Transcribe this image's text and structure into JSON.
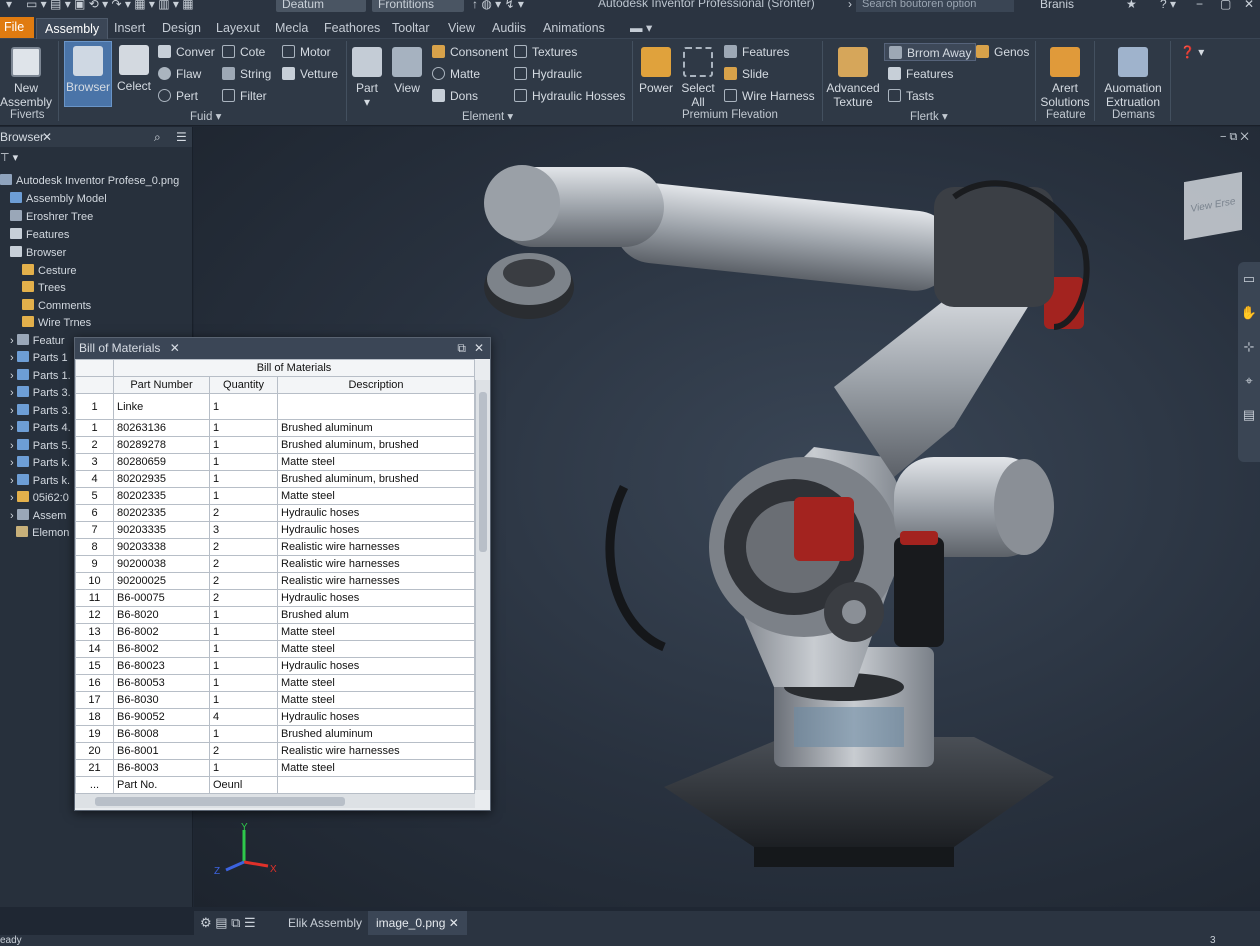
{
  "titlebar": {
    "combo1": "Deatum",
    "combo2": "Frontitions",
    "app_title": "Autodesk Inventor Professional (Sronter)",
    "search_placeholder": "Search boutoren option",
    "user": "Branis"
  },
  "menu": {
    "file": "File",
    "tabs": [
      "Assembly",
      "Insert",
      "Design",
      "Layexut",
      "Mecla",
      "Feathores",
      "Tooltar",
      "View",
      "Audiis",
      "Animations"
    ]
  },
  "ribbon": {
    "fiverts": {
      "new_assembly": "New Assembly",
      "label": "Fiverts"
    },
    "fuid": {
      "browser": "Browser",
      "celect": "Celect",
      "small": [
        "Conver",
        "Flaw",
        "Pert",
        "Cote",
        "String",
        "Filter",
        "Motor",
        "Vetture"
      ],
      "label": "Fuid"
    },
    "element": {
      "part": "Part",
      "view": "View",
      "small": [
        "Consonent",
        "Matte",
        "Dons",
        "Textures",
        "Hydraulic",
        "Hydraulic Hosses"
      ],
      "label": "Element"
    },
    "premium": {
      "power": "Power",
      "select_all": "Select All",
      "small": [
        "Features",
        "Slide",
        "Wire Harness"
      ],
      "label": "Premium Flevation"
    },
    "flertk": {
      "advanced_texture": "Advanced Texture",
      "small": [
        "Brrom Away",
        "Features",
        "Tasts",
        "Genos"
      ],
      "label": "Flertk"
    },
    "feature": {
      "arert_solutions": "Arert Solutions",
      "label": "Feature"
    },
    "demans": {
      "automation": "Auomation Extruation",
      "label": "Demans"
    }
  },
  "browser": {
    "tab": "Browser",
    "root": "Autodesk Inventor Profese_0.png",
    "items": [
      "Assembly Model",
      "Eroshrer Tree",
      "Features",
      "Browser",
      "Cesture",
      "Trees",
      "Comments",
      "Wire Trnes",
      "Featur",
      "Parts 1",
      "Parts 1.",
      "Parts 3.",
      "Parts 3.",
      "Parts 4.",
      "Parts 5.",
      "Parts k.",
      "Parts k.",
      "05i62:0",
      "Assem",
      "Elemon"
    ]
  },
  "bom": {
    "window_title": "Bill of Materials",
    "table_title": "Bill of Materials",
    "columns": [
      "",
      "Part Number",
      "Quantity",
      "Description"
    ],
    "first_row": [
      "1",
      "Linke",
      "1",
      ""
    ],
    "rows": [
      [
        "1",
        "80263136",
        "1",
        "Brushed aluminum"
      ],
      [
        "2",
        "80289278",
        "1",
        "Brushed aluminum, brushed"
      ],
      [
        "3",
        "80280659",
        "1",
        "Matte steel"
      ],
      [
        "4",
        "80202935",
        "1",
        "Brushed aluminum, brushed"
      ],
      [
        "5",
        "80202335",
        "1",
        "Matte steel"
      ],
      [
        "6",
        "80202335",
        "2",
        "Hydraulic hoses"
      ],
      [
        "7",
        "90203335",
        "3",
        "Hydraulic hoses"
      ],
      [
        "8",
        "90203338",
        "2",
        "Realistic wire harnesses"
      ],
      [
        "9",
        "90200038",
        "2",
        "Realistic wire harnesses"
      ],
      [
        "10",
        "90200025",
        "2",
        "Realistic wire harnesses"
      ],
      [
        "11",
        "B6-00075",
        "2",
        "Hydraulic hoses"
      ],
      [
        "12",
        "B6-8020",
        "1",
        "Brushed alum"
      ],
      [
        "13",
        "B6-8002",
        "1",
        "Matte steel"
      ],
      [
        "14",
        "B6-8002",
        "1",
        "Matte steel"
      ],
      [
        "15",
        "B6-80023",
        "1",
        "Hydraulic hoses"
      ],
      [
        "16",
        "B6-80053",
        "1",
        "Matte steel"
      ],
      [
        "17",
        "B6-8030",
        "1",
        "Matte steel"
      ],
      [
        "18",
        "B6-90052",
        "4",
        "Hydraulic hoses"
      ],
      [
        "19",
        "B6-8008",
        "1",
        "Brushed aluminum"
      ],
      [
        "20",
        "B6-8001",
        "2",
        "Realistic wire harnesses"
      ],
      [
        "21",
        "B6-8003",
        "1",
        "Matte steel"
      ]
    ],
    "last_row": [
      "...",
      "Part No.",
      "Oeunl",
      ""
    ]
  },
  "viewcube": {
    "face1": "View",
    "face2": "Erse"
  },
  "doctabs": {
    "tab1": "Elik Assembly",
    "tab2": "image_0.png"
  },
  "status": {
    "left": "eady",
    "right": "3"
  },
  "colors": {
    "accent": "#e07b10",
    "selection": "#4a74a8"
  }
}
